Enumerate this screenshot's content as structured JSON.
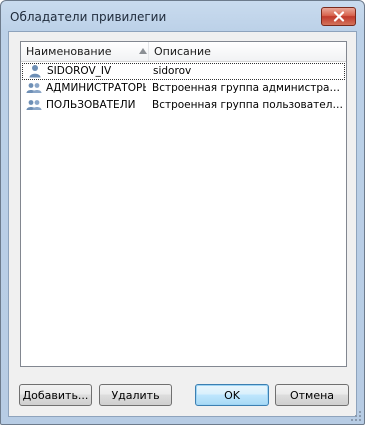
{
  "window": {
    "title": "Обладатели привилегии",
    "close_icon": "close-icon"
  },
  "list": {
    "columns": {
      "name": "Наименование",
      "description": "Описание",
      "sort_icon": "sort-ascending-icon"
    },
    "rows": [
      {
        "icon": "user-icon",
        "name": "SIDOROV_IV",
        "description": "sidorov"
      },
      {
        "icon": "group-icon",
        "name": "АДМИНИСТРАТОРЫ",
        "description": "Встроенная группа администрато..."
      },
      {
        "icon": "group-icon",
        "name": "ПОЛЬЗОВАТЕЛИ",
        "description": "Встроенная группа пользователей"
      }
    ]
  },
  "buttons": {
    "add": "Добавить...",
    "delete": "Удалить",
    "ok": "OK",
    "cancel": "Отмена"
  },
  "colors": {
    "frame": "#b9cde5",
    "close": "#c0392b",
    "default_button": "#3c7fb1",
    "user_icon": "#6e8fb5"
  }
}
